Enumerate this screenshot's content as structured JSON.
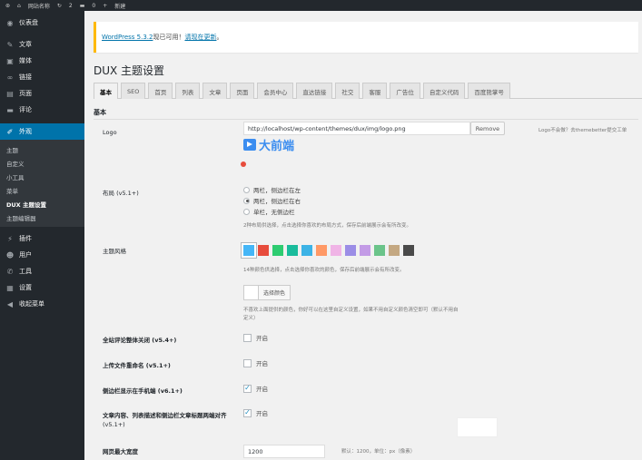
{
  "admin_bar": {
    "site_name": "网站名称",
    "updates": "2",
    "comments": "0",
    "new_label": "新建"
  },
  "sidebar": {
    "items_top": [
      {
        "icon": "dashboard-icon",
        "glyph": "◉",
        "label": "仪表盘"
      },
      {
        "icon": "pin-icon",
        "glyph": "✎",
        "label": "文章"
      },
      {
        "icon": "media-icon",
        "glyph": "▣",
        "label": "媒体"
      },
      {
        "icon": "link-icon",
        "glyph": "∞",
        "label": "链接"
      },
      {
        "icon": "page-icon",
        "glyph": "▤",
        "label": "页面"
      },
      {
        "icon": "comment-icon",
        "glyph": "▬",
        "label": "评论"
      }
    ],
    "active": {
      "icon": "paintbrush-icon",
      "glyph": "✐",
      "label": "外观"
    },
    "submenu": [
      "主题",
      "自定义",
      "小工具",
      "菜单",
      "DUX 主题设置",
      "主题编辑器"
    ],
    "current_submenu": "DUX 主题设置",
    "items_bottom": [
      {
        "icon": "plugin-icon",
        "glyph": "⚡",
        "label": "插件"
      },
      {
        "icon": "users-icon",
        "glyph": "☻",
        "label": "用户"
      },
      {
        "icon": "tools-icon",
        "glyph": "✆",
        "label": "工具"
      },
      {
        "icon": "settings-icon",
        "glyph": "▦",
        "label": "设置"
      },
      {
        "icon": "collapse-icon",
        "glyph": "◀",
        "label": "收起菜单"
      }
    ]
  },
  "notice": {
    "link1": "WordPress 5.3.2",
    "text": "现已可用！",
    "link2": "请现在更新",
    "end": "。"
  },
  "page_title": "DUX 主题设置",
  "tabs": [
    "基本",
    "SEO",
    "首页",
    "列表",
    "文章",
    "页面",
    "会员中心",
    "直达链接",
    "社交",
    "客服",
    "广告位",
    "自定义代码",
    "百度熊掌号"
  ],
  "active_tab": "基本",
  "section_title": "基本",
  "logo": {
    "label": "Logo",
    "value": "http://localhost/wp-content/themes/dux/img/logo.png",
    "remove": "Remove",
    "hint": "Logo不会做？去themebetter提交工单",
    "preview_text": "大前端"
  },
  "layout": {
    "label": "布局 (v5.1+)",
    "options": [
      "两栏，侧边栏在左",
      "两栏，侧边栏在右",
      "单栏，无侧边栏"
    ],
    "selected_index": 1,
    "desc": "2种布局供选择，点击选择你喜欢的布局方式，保存后前端展示会有所改变。"
  },
  "theme_style": {
    "label": "主题风格",
    "colors": [
      "#45b6f7",
      "#e74c3c",
      "#2ecc71",
      "#1abc9c",
      "#3cb3e6",
      "#ff9966",
      "#f0b4e6",
      "#9b8de6",
      "#c39be6",
      "#6bc48a",
      "#c4a882",
      "#4a4a4a"
    ],
    "selected_index": 0,
    "desc": "14种颜色供选择，点击选择你喜欢的颜色，保存后前端展示会有所改变。",
    "custom_button": "选择颜色",
    "custom_desc_1": "不喜欢上面提供的颜色，你好可以在这里自定义设置，如果不用自定义颜色清空即可（默认不用自",
    "custom_desc_2": "定义）"
  },
  "switches": [
    {
      "label": "全站评论整体关闭 (v5.4+)",
      "checked": false,
      "text": "开启"
    },
    {
      "label": "上传文件重命名 (v5.1+)",
      "checked": false,
      "text": "开启"
    },
    {
      "label": "侧边栏显示在手机端 (v6.1+)",
      "checked": true,
      "text": "开启"
    },
    {
      "label": "文章内容、列表描述和侧边栏文章标题两端对齐",
      "label2": "(v5.1+)",
      "checked": true,
      "text": "开启"
    }
  ],
  "max_width": {
    "label": "网页最大宽度",
    "value": "1200",
    "desc": "默认：1200，单位：px（像素）"
  }
}
